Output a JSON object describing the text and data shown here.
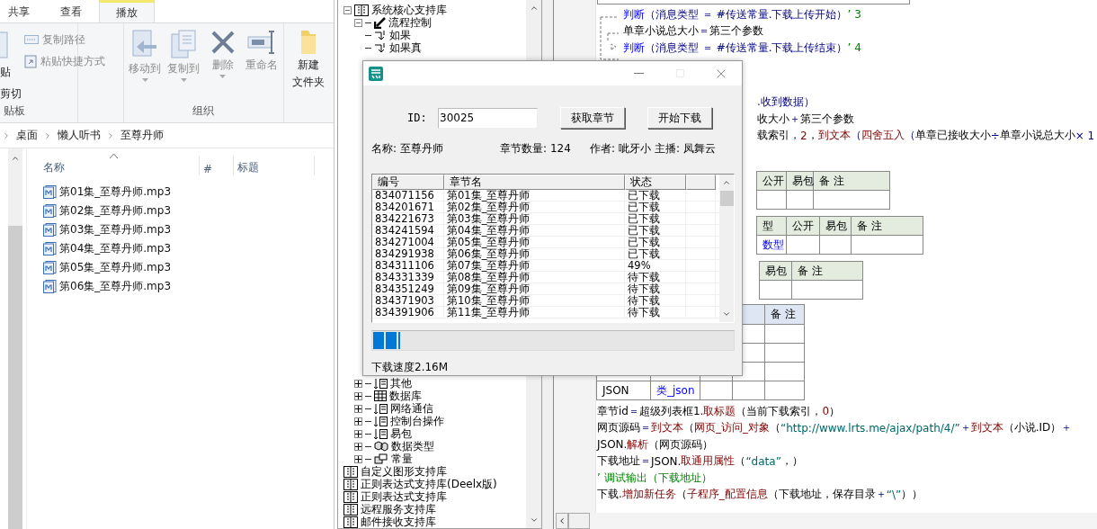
{
  "explorer": {
    "tabs": [
      {
        "label": "共享",
        "selected": false
      },
      {
        "label": "查看",
        "selected": false
      },
      {
        "label": "播放",
        "selected": true
      }
    ],
    "clipboard": {
      "paste": "贴",
      "cut": "剪切",
      "copy_path": {
        "label": "复制路径",
        "disabled": true
      },
      "paste_shortcut": {
        "label": "粘贴快捷方式",
        "disabled": true
      },
      "group": "贴板"
    },
    "organize": {
      "buttons": [
        {
          "label": "移动到",
          "kind": "move",
          "disabled": true
        },
        {
          "label": "复制到",
          "kind": "copy",
          "disabled": true
        },
        {
          "label": "删除",
          "kind": "delete",
          "disabled": true
        },
        {
          "label": "重命名",
          "kind": "rename",
          "disabled": true
        }
      ],
      "group": "组织"
    },
    "new_folder": {
      "lines": [
        "新建",
        "文件夹"
      ],
      "disabled": false
    },
    "path": [
      "桌面",
      "懒人听书",
      "至尊丹师"
    ],
    "columns": [
      "名称",
      "#",
      "标题"
    ],
    "files": [
      "第01集_至尊丹师.mp3",
      "第02集_至尊丹师.mp3",
      "第03集_至尊丹师.mp3",
      "第04集_至尊丹师.mp3",
      "第05集_至尊丹师.mp3",
      "第06集_至尊丹师.mp3"
    ]
  },
  "tree": {
    "items": [
      {
        "label": "系统核心支持库",
        "kind": "library",
        "expanded": true,
        "children": [
          {
            "label": "流程控制",
            "kind": "arrow",
            "expanded": true,
            "children": [
              {
                "label": "如果",
                "kind": "branch"
              },
              {
                "label": "如果真",
                "kind": "branch"
              }
            ]
          },
          {
            "label": "其他",
            "kind": "list",
            "expanded": false
          },
          {
            "label": "数据库",
            "kind": "grid",
            "expanded": false
          },
          {
            "label": "网络通信",
            "kind": "list",
            "expanded": false
          },
          {
            "label": "控制台操作",
            "kind": "list",
            "expanded": false
          },
          {
            "label": "易包",
            "kind": "list",
            "expanded": false
          },
          {
            "label": "数据类型",
            "kind": "types",
            "expanded": false
          },
          {
            "label": "常量",
            "kind": "const",
            "expanded": false
          }
        ]
      },
      {
        "label": "自定义图形支持库",
        "kind": "library"
      },
      {
        "label": "正则表达式支持库(Deelx版)",
        "kind": "library"
      },
      {
        "label": "正则表达式支持库",
        "kind": "library"
      },
      {
        "label": "远程服务支持库",
        "kind": "library"
      },
      {
        "label": "邮件接收支持库",
        "kind": "library"
      }
    ]
  },
  "code": {
    "top_lines": [
      [
        {
          "t": "判断",
          "kind": "keyword"
        },
        {
          "t": "（消息类型 ＝ #传送常量.下载上传开始）",
          "kind": "op"
        },
        {
          "t": " ’ 3",
          "kind": "comment"
        }
      ],
      [
        {
          "t": "单章小说总大小",
          "kind": "plain"
        },
        {
          "t": " ＝ ",
          "kind": "op"
        },
        {
          "t": "第三个参数",
          "kind": "plain"
        }
      ],
      [
        {
          "t": "判断",
          "kind": "keyword"
        },
        {
          "t": "（消息类型 ＝ #传送常量.下载上传结束）",
          "kind": "op"
        },
        {
          "t": " ’ 4",
          "kind": "comment"
        }
      ]
    ],
    "partial_lines": [
      [
        {
          "t": ".收到数据）",
          "kind": "op"
        }
      ],
      [
        {
          "t": "收大小",
          "kind": "plain"
        },
        {
          "t": " ＋ ",
          "kind": "op"
        },
        {
          "t": "第三个参数",
          "kind": "plain"
        }
      ],
      [
        {
          "t": "载索引，",
          "kind": "plain"
        },
        {
          "t": "2",
          "kind": "func"
        },
        {
          "t": "，",
          "kind": "plain"
        },
        {
          "t": "到文本",
          "kind": "func"
        },
        {
          "t": "（",
          "kind": "op"
        },
        {
          "t": "四舍五入",
          "kind": "func"
        },
        {
          "t": "（",
          "kind": "op"
        },
        {
          "t": "单章已接收大小",
          "kind": "plain"
        },
        {
          "t": " ÷ ",
          "kind": "op"
        },
        {
          "t": "单章小说总大小",
          "kind": "plain"
        },
        {
          "t": " × 1",
          "kind": "op"
        }
      ]
    ],
    "tables": [
      {
        "columns": [
          "公开",
          "易包",
          "备 注"
        ],
        "highlighted": false
      },
      {
        "columns": [
          "型",
          "公开",
          "易包",
          "备 注"
        ],
        "highlighted": false,
        "row": [
          {
            "t": "数型",
            "link": true
          }
        ]
      },
      {
        "columns": [
          "易包",
          "备 注"
        ],
        "highlighted": false
      }
    ],
    "member_table": {
      "columns": [
        "备 注"
      ],
      "highlighted": true,
      "last_row": [
        {
          "t": "JSON",
          "link": false
        },
        {
          "t": "类_json",
          "link": true
        }
      ]
    },
    "bottom_lines": [
      [
        {
          "t": "章节id",
          "kind": "plain"
        },
        {
          "t": " ＝ ",
          "kind": "op"
        },
        {
          "t": "超级列表框1.",
          "kind": "plain"
        },
        {
          "t": "取标题",
          "kind": "func"
        },
        {
          "t": "（当前下载索引，",
          "kind": "plain"
        },
        {
          "t": "0",
          "kind": "func"
        },
        {
          "t": "）",
          "kind": "plain"
        }
      ],
      [
        {
          "t": "网页源码",
          "kind": "plain"
        },
        {
          "t": " ＝ ",
          "kind": "op"
        },
        {
          "t": "到文本",
          "kind": "func"
        },
        {
          "t": "（",
          "kind": "plain"
        },
        {
          "t": "网页_访问_对象",
          "kind": "func"
        },
        {
          "t": "（",
          "kind": "plain"
        },
        {
          "t": "“http://www.lrts.me/ajax/path/4/”",
          "kind": "string"
        },
        {
          "t": " ＋ ",
          "kind": "op"
        },
        {
          "t": "到文本",
          "kind": "func"
        },
        {
          "t": "（小说.ID）",
          "kind": "plain"
        },
        {
          "t": " ＋",
          "kind": "op"
        }
      ],
      [
        {
          "t": "JSON.",
          "kind": "plain"
        },
        {
          "t": "解析",
          "kind": "func"
        },
        {
          "t": "（网页源码）",
          "kind": "plain"
        }
      ],
      [
        {
          "t": "下载地址",
          "kind": "plain"
        },
        {
          "t": " ＝ ",
          "kind": "op"
        },
        {
          "t": "JSON.",
          "kind": "plain"
        },
        {
          "t": "取通用属性",
          "kind": "func"
        },
        {
          "t": "（",
          "kind": "plain"
        },
        {
          "t": "“data”",
          "kind": "string"
        },
        {
          "t": "，）",
          "kind": "plain"
        }
      ],
      [
        {
          "t": "’ 调试输出（下载地址）",
          "kind": "comment"
        }
      ],
      [
        {
          "t": "下载.",
          "kind": "plain"
        },
        {
          "t": "增加新任务",
          "kind": "func"
        },
        {
          "t": "（",
          "kind": "plain"
        },
        {
          "t": "子程序_配置信息",
          "kind": "func"
        },
        {
          "t": "（下载地址，保存目录",
          "kind": "plain"
        },
        {
          "t": " ＋ ",
          "kind": "op"
        },
        {
          "t": "“\\”",
          "kind": "string"
        },
        {
          "t": "））",
          "kind": "plain"
        }
      ]
    ]
  },
  "dialog": {
    "id_label": "ID:",
    "id_value": "30025",
    "buttons": [
      "获取章节",
      "开始下载"
    ],
    "info": [
      {
        "label": "名称:",
        "value": "至尊丹师"
      },
      {
        "label": "章节数量:",
        "value": "124"
      },
      {
        "label": "作者:",
        "value": "呲牙小"
      },
      {
        "label": "主播:",
        "value": "凤舞云"
      }
    ],
    "columns": [
      "编号",
      "章节名",
      "状态"
    ],
    "rows": [
      [
        "834071156",
        "第01集_至尊丹师",
        "已下载"
      ],
      [
        "834201671",
        "第02集_至尊丹师",
        "已下载"
      ],
      [
        "834221673",
        "第03集_至尊丹师",
        "已下载"
      ],
      [
        "834241594",
        "第04集_至尊丹师",
        "已下载"
      ],
      [
        "834271004",
        "第05集_至尊丹师",
        "已下载"
      ],
      [
        "834291938",
        "第06集_至尊丹师",
        "已下载"
      ],
      [
        "834311106",
        "第07集_至尊丹师",
        "49%"
      ],
      [
        "834331339",
        "第08集_至尊丹师",
        "待下载"
      ],
      [
        "834351249",
        "第09集_至尊丹师",
        "待下载"
      ],
      [
        "834371903",
        "第10集_至尊丹师",
        "待下载"
      ],
      [
        "834391906",
        "第11集_至尊丹师",
        "待下载"
      ]
    ],
    "progress": {
      "level": 0.075
    },
    "speed": "下载速度2.16M"
  }
}
